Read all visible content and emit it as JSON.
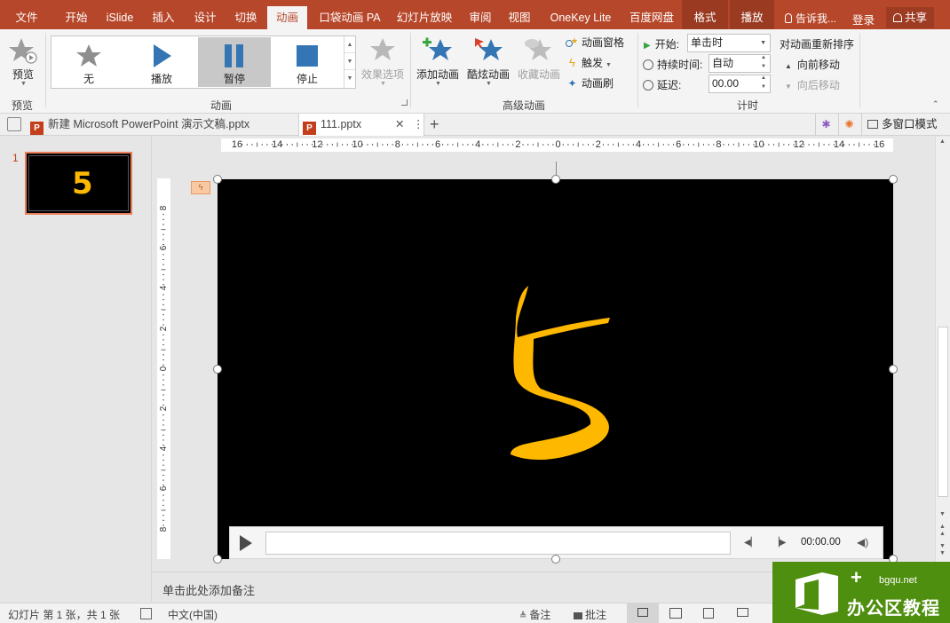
{
  "ribbon_tabs": [
    {
      "label": "文件"
    },
    {
      "label": "开始"
    },
    {
      "label": "iSlide"
    },
    {
      "label": "插入"
    },
    {
      "label": "设计"
    },
    {
      "label": "切换"
    },
    {
      "label": "动画"
    },
    {
      "label": "口袋动画 PA"
    },
    {
      "label": "幻灯片放映"
    },
    {
      "label": "审阅"
    },
    {
      "label": "视图"
    },
    {
      "label": "OneKey Lite"
    },
    {
      "label": "百度网盘"
    },
    {
      "label": "格式"
    },
    {
      "label": "播放"
    }
  ],
  "active_tab": "动画",
  "tell_me": "告诉我...",
  "login": "登录",
  "share": "共享",
  "ribbon": {
    "preview": {
      "label": "预览",
      "group": "预览"
    },
    "animation_gallery": {
      "items": [
        {
          "label": "无"
        },
        {
          "label": "播放"
        },
        {
          "label": "暂停"
        },
        {
          "label": "停止"
        }
      ],
      "selected": "暂停",
      "group": "动画"
    },
    "effect_options": "效果选项",
    "advanced": {
      "add_animation": "添加动画",
      "cool_animation": "酷炫动画",
      "collect_animation": "收藏动画",
      "animation_pane": "动画窗格",
      "trigger": "触发",
      "animation_painter": "动画刷",
      "group": "高级动画"
    },
    "timing": {
      "start_label": "开始:",
      "start_value": "单击时",
      "duration_label": "持续时间:",
      "duration_value": "自动",
      "delay_label": "延迟:",
      "delay_value": "00.00",
      "group": "计时"
    },
    "reorder": {
      "title": "对动画重新排序",
      "move_earlier": "向前移动",
      "move_later": "向后移动"
    }
  },
  "doc_tabs": [
    {
      "label": "新建 Microsoft PowerPoint 演示文稿.pptx"
    },
    {
      "label": "111.pptx"
    }
  ],
  "multi_window": "多窗口模式",
  "thumbnails": [
    {
      "number": "1"
    }
  ],
  "slide": {
    "glyph": "5"
  },
  "ruler": {
    "h_ticks": [
      "16",
      "14",
      "12",
      "10",
      "8",
      "6",
      "4",
      "2",
      "0",
      "2",
      "4",
      "6",
      "8",
      "10",
      "12",
      "14",
      "16"
    ],
    "v_ticks": [
      "8",
      "6",
      "4",
      "2",
      "0",
      "2",
      "4",
      "6",
      "8"
    ]
  },
  "player": {
    "time": "00:00.00"
  },
  "notes_placeholder": "单击此处添加备注",
  "status": {
    "slide_info": "幻灯片 第 1 张，共 1 张",
    "language": "中文(中国)",
    "notes": "备注",
    "comments": "批注"
  },
  "watermark": {
    "site": "bgqu.net",
    "name": "办公区教程"
  },
  "colors": {
    "accent": "#b7472a",
    "glyph": "#ffb800",
    "watermark": "#4f8f0f"
  }
}
